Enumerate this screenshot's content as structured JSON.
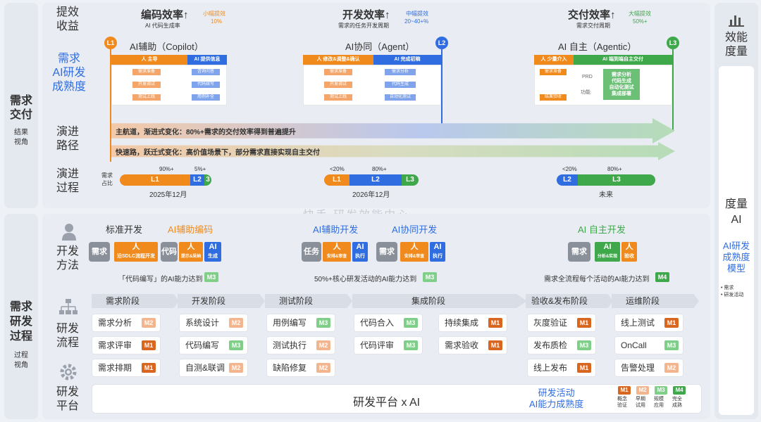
{
  "left": {
    "top_label": "需求\n交付",
    "top_sub": "结果\n视角",
    "bottom_label": "需求\n研发\n过程",
    "bottom_sub": "过程\n视角"
  },
  "right": {
    "title": "效能\n度量",
    "measure": "度量\nAI",
    "model": "AI研发\n成熟度\n模型",
    "bullet1": "• 需求",
    "bullet2": "• 研发活动"
  },
  "top": {
    "row_label_benefit": "提效\n收益",
    "row_label_maturity": "需求\nAI研发\n成熟度",
    "row_label_path": "演进\n路径",
    "row_label_process": "演进\n过程",
    "benefits": [
      {
        "title": "编码效率↑",
        "sub": "AI 代码生成率",
        "tag": "小幅提效",
        "val": "10%"
      },
      {
        "title": "开发效率↑",
        "sub": "需求的任务开发周期",
        "tag": "中幅提效",
        "val": "20~40+%"
      },
      {
        "title": "交付效率↑",
        "sub": "需求交付周期",
        "tag": "大幅提效",
        "val": "50%+"
      }
    ],
    "levels": [
      {
        "code": "L1",
        "name": "AI辅助（Copilot）",
        "left_bar": "人 主导",
        "right_bar": "AI 提供信息",
        "left_items": [
          "需求准备",
          "开发调试",
          "测试上线"
        ],
        "right_items": [
          "咨询问答",
          "代码续写",
          "用例补全"
        ]
      },
      {
        "code": "L2",
        "name": "AI协同（Agent）",
        "left_bar": "人 修改&调整&确认",
        "right_bar": "AI 完成初稿",
        "left_items": [
          "需求准备",
          "开发调试",
          "测试上线"
        ],
        "right_items": [
          "需求分析",
          "代码生成",
          "自动化测试"
        ]
      },
      {
        "code": "L3",
        "name": "AI 自主（Agentic）",
        "left_bar": "人 少量介入",
        "right_bar": "AI 端到端自主交付",
        "left_items": [
          "需求准备",
          "结果验收"
        ],
        "mid_items": [
          "PRD",
          "功能"
        ],
        "right_items": [
          "需求分析",
          "代码生成",
          "自动化测试",
          "集成部署"
        ]
      }
    ],
    "path1": "主航道，渐进式变化：80%+需求的交付效率得到普遍提升",
    "path2": "快速路，跃迁式变化：高价值场景下，部分需求直接实现自主交付",
    "process": {
      "ratio_label": "需求\n占比",
      "groups": [
        {
          "pcts": [
            "90%+",
            "5%+"
          ],
          "segs": [
            "L1",
            "L2",
            "3"
          ],
          "date": "2025年12月"
        },
        {
          "pcts": [
            "<20%",
            "80%+"
          ],
          "segs": [
            "L1",
            "L2",
            "L3"
          ],
          "date": "2026年12月"
        },
        {
          "pcts": [
            "<20%",
            "80%+"
          ],
          "segs": [
            "L2",
            "L3"
          ],
          "date": "未来"
        }
      ]
    }
  },
  "watermark": "快手 研发效能中心",
  "bottom": {
    "method_label": "开发\n方法",
    "flow_label": "研发\n流程",
    "platform_label": "研发\n平台",
    "methods": [
      {
        "t1": "标准开发",
        "t2": "AI辅助编码",
        "note": "「代码编写」的AI能力达到",
        "badge": "M3",
        "boxes": [
          "需求",
          "人",
          "沿SDLC流程开发",
          "代码",
          "人",
          "提示&采纳",
          "AI",
          "生成"
        ]
      },
      {
        "t1": "AI辅助开发",
        "t2": "AI协同开发",
        "note": "50%+核心研发活动的AI能力达到",
        "badge": "M3",
        "boxes": [
          "任务",
          "人",
          "安排&审查",
          "AI",
          "执行",
          "需求",
          "人",
          "安排&审查",
          "AI",
          "执行"
        ]
      },
      {
        "t1": "AI 自主开发",
        "note": "需求全流程每个活动的AI能力达到",
        "badge": "M4",
        "boxes": [
          "需求",
          "AI",
          "分析&实现",
          "人",
          "验收"
        ]
      }
    ],
    "phases": [
      "需求阶段",
      "开发阶段",
      "测试阶段",
      "集成阶段",
      "验收&发布阶段",
      "运维阶段"
    ],
    "activities": [
      {
        "n": "需求分析",
        "m": "M2"
      },
      {
        "n": "需求评审",
        "m": "M1"
      },
      {
        "n": "需求排期",
        "m": "M1"
      },
      {
        "n": "系统设计",
        "m": "M2"
      },
      {
        "n": "代码编写",
        "m": "M3"
      },
      {
        "n": "自测&联调",
        "m": "M2"
      },
      {
        "n": "用例编写",
        "m": "M3"
      },
      {
        "n": "测试执行",
        "m": "M2"
      },
      {
        "n": "缺陷修复",
        "m": "M2"
      },
      {
        "n": "代码合入",
        "m": "M3"
      },
      {
        "n": "代码评审",
        "m": "M3"
      },
      {
        "n": "持续集成",
        "m": "M1"
      },
      {
        "n": "需求验收",
        "m": "M1"
      },
      {
        "n": "灰度验证",
        "m": "M1"
      },
      {
        "n": "发布质检",
        "m": "M3"
      },
      {
        "n": "线上发布",
        "m": "M1"
      },
      {
        "n": "线上测试",
        "m": "M1"
      },
      {
        "n": "OnCall",
        "m": "M3"
      },
      {
        "n": "告警处理",
        "m": "M2"
      }
    ],
    "platform": "研发平台 x AI",
    "capability": "研发活动\nAI能力成熟度",
    "legend": [
      {
        "m": "M1",
        "t": "概念\n验证"
      },
      {
        "m": "M2",
        "t": "早期\n试用"
      },
      {
        "m": "M3",
        "t": "规模\n应用"
      },
      {
        "m": "M4",
        "t": "完全\n成熟"
      }
    ]
  }
}
